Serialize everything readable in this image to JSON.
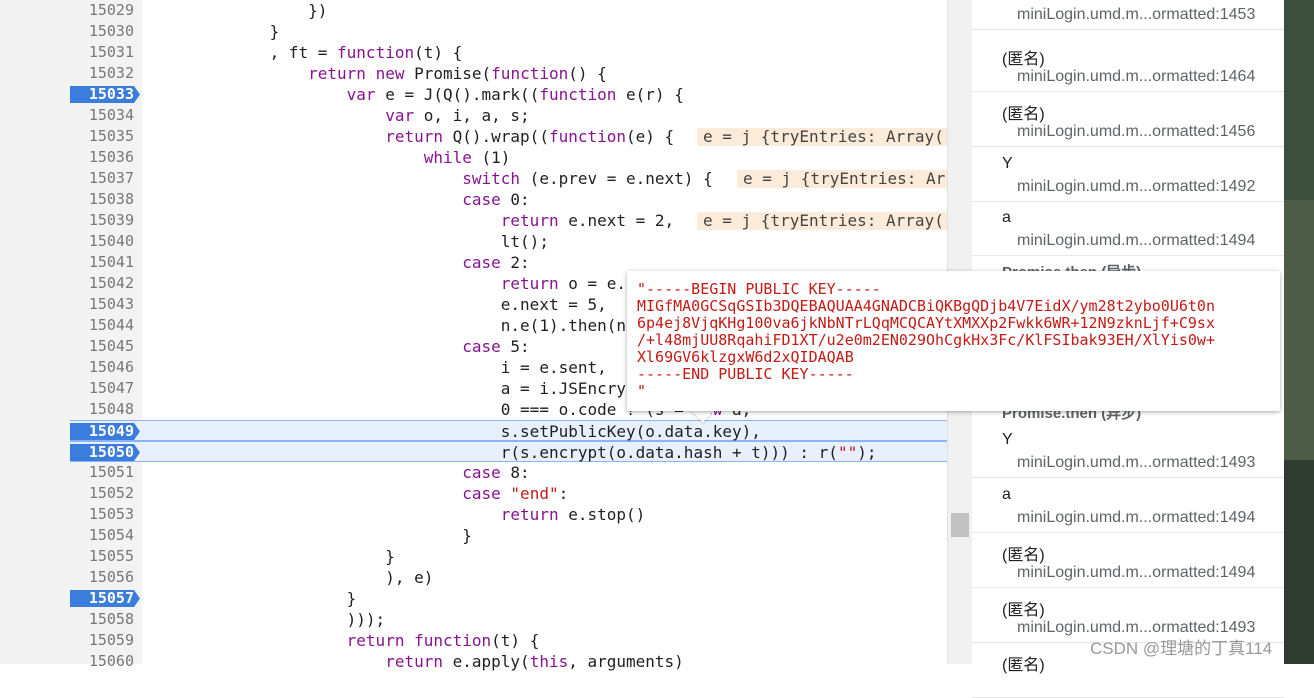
{
  "code": {
    "lines": [
      {
        "n": "15029",
        "t": "                })"
      },
      {
        "n": "15030",
        "t": "            }"
      },
      {
        "n": "15031",
        "t": "            , ft = function(t) {"
      },
      {
        "n": "15032",
        "t": "                return new Promise(function() {"
      },
      {
        "n": "15033",
        "t": "                    var e = J(Q().mark((function e(r) {"
      },
      {
        "n": "15034",
        "t": "                        var o, i, a, s;"
      },
      {
        "n": "15035",
        "t": "                        return Q().wrap((function(e) {"
      },
      {
        "n": "15036",
        "t": "                            while (1)"
      },
      {
        "n": "15037",
        "t": "                                switch (e.prev = e.next) {"
      },
      {
        "n": "15038",
        "t": "                                case 0:"
      },
      {
        "n": "15039",
        "t": "                                    return e.next = 2,"
      },
      {
        "n": "15040",
        "t": "                                    lt();"
      },
      {
        "n": "15041",
        "t": "                                case 2:"
      },
      {
        "n": "15042",
        "t": "                                    return o = e."
      },
      {
        "n": "15043",
        "t": "                                    e.next = 5,"
      },
      {
        "n": "15044",
        "t": "                                    n.e(1).then(n"
      },
      {
        "n": "15045",
        "t": "                                case 5:"
      },
      {
        "n": "15046",
        "t": "                                    i = e.sent,"
      },
      {
        "n": "15047",
        "t": "                                    a = i.JSEncry"
      },
      {
        "n": "15048",
        "t": "                                    0 === o.code ? (s = new a,"
      },
      {
        "n": "15049",
        "t": "                                    s.setPublicKey(o.data.key),"
      },
      {
        "n": "15050",
        "t": "                                    r(s.encrypt(o.data.hash + t))) : r(\"\");"
      },
      {
        "n": "15051",
        "t": "                                case 8:"
      },
      {
        "n": "15052",
        "t": "                                case \"end\":"
      },
      {
        "n": "15053",
        "t": "                                    return e.stop()"
      },
      {
        "n": "15054",
        "t": "                                }"
      },
      {
        "n": "15055",
        "t": "                        }"
      },
      {
        "n": "15056",
        "t": "                        ), e)"
      },
      {
        "n": "15057",
        "t": "                    }"
      },
      {
        "n": "15058",
        "t": "                    )));"
      },
      {
        "n": "15059",
        "t": "                    return function(t) {"
      },
      {
        "n": "15060",
        "t": "                        return e.apply(this, arguments)"
      }
    ],
    "inline_values": {
      "l15035": "e = j {tryEntries: Array(",
      "l15037": "e = j {tryEntries: Ar",
      "l15039": "e = j {tryEntries: Array("
    }
  },
  "popover": {
    "text": "\"-----BEGIN PUBLIC KEY-----\nMIGfMA0GCSqGSIb3DQEBAQUAA4GNADCBiQKBgQDjb4V7EidX/ym28t2ybo0U6t0n\n6p4ej8VjqKHg100va6jkNbNTrLQqMCQCAYtXMXXp2Fwkk6WR+12N9zknLjf+C9sx\n/+l48mjUU8RqahiFD1XT/u2e0m2EN029OhCgkHx3Fc/KlFSIbak93EH/XlYis0w+\nXl69GV6klzgxW6d2xQIDAQAB\n-----END PUBLIC KEY-----\n\""
  },
  "callstack": {
    "frames": [
      {
        "name": "↑",
        "loc": "miniLogin.umd.m...ormatted:1453"
      },
      {
        "name": "(匿名)",
        "loc": "miniLogin.umd.m...ormatted:1464"
      },
      {
        "name": "(匿名)",
        "loc": "miniLogin.umd.m...ormatted:1456"
      },
      {
        "name": "Y",
        "loc": "miniLogin.umd.m...ormatted:1492"
      },
      {
        "name": "a",
        "loc": "miniLogin.umd.m...ormatted:1494"
      },
      {
        "name": "Y",
        "loc": "miniLogin.umd.m...ormatted:1493"
      },
      {
        "name": "a",
        "loc": "miniLogin.umd.m...ormatted:1494"
      },
      {
        "name": "(匿名)",
        "loc": "miniLogin.umd.m...ormatted:1494"
      },
      {
        "name": "(匿名)",
        "loc": "miniLogin.umd.m...ormatted:1493"
      },
      {
        "name": "(匿名)",
        "loc": ""
      }
    ],
    "async_labels": [
      "Promise.then (异步)",
      "Promise.then (异步)"
    ]
  },
  "watermark": "CSDN @理塘的丁真114"
}
